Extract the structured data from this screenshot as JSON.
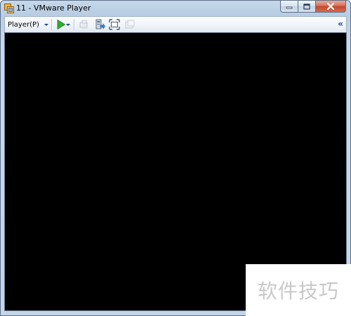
{
  "window": {
    "title": "11 - VMware Player"
  },
  "toolbar": {
    "player_menu_label": "Player(P)",
    "collapse_glyph": "«",
    "icons": [
      "play-icon",
      "send-ctrl-alt-del-icon",
      "removable-devices-icon",
      "full-screen-icon",
      "unity-icon"
    ]
  },
  "colors": {
    "play_green": "#2eae2e",
    "vm_background": "#000000",
    "accent_blue": "#1d3f8f"
  },
  "watermark": {
    "text": "软件技巧"
  }
}
